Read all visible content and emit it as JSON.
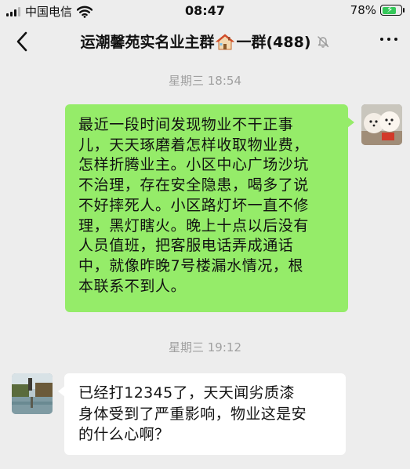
{
  "status_bar": {
    "carrier": "中国电信",
    "time": "08:47",
    "battery_percent": "78%",
    "battery_level": 0.78,
    "battery_color": "#34c759"
  },
  "header": {
    "back_icon": "chevron-left-icon",
    "title_prefix": "运潮馨苑实名业主群",
    "title_icon": "house-icon",
    "title_suffix": "一群(488)",
    "mute_icon": "bell-muted-icon",
    "more_icon": "more-dots-icon"
  },
  "messages": [
    {
      "timestamp": "星期三 18:54",
      "sender": "self",
      "avatar_icon": "pomeranian-dogs-avatar",
      "text": "最近一段时间发现物业不干正事\n儿，天天琢磨着怎样收取物业费，\n怎样折腾业主。小区中心广场沙坑\n不治理，存在安全隐患，喝多了说\n不好摔死人。小区路灯坏一直不修\n理，黑灯瞎火。晚上十点以后没有\n人员值班，把客服电话弄成通话\n中，就像昨晚7号楼漏水情况，根\n本联系不到人。",
      "bubble_color": "#95ec69"
    },
    {
      "timestamp": "星期三 19:12",
      "sender": "other",
      "avatar_icon": "lake-landscape-avatar",
      "text": "已经打12345了，天天闻劣质漆\n身体受到了严重影响，物业这是安\n的什么心啊？",
      "bubble_color": "#ffffff"
    }
  ],
  "colors": {
    "background": "#ededed",
    "timestamp": "#a0a0a0"
  }
}
